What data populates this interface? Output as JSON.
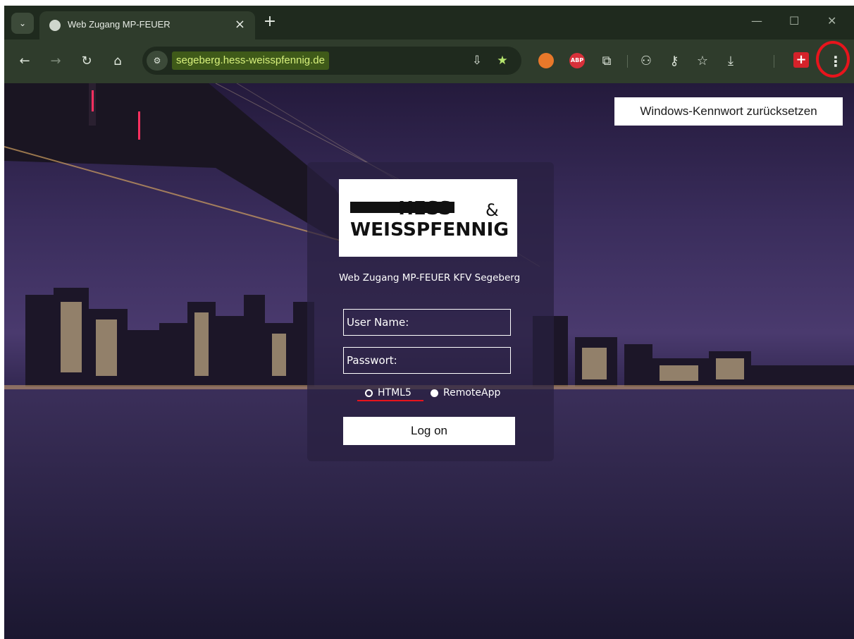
{
  "browser": {
    "tab_title": "Web Zugang MP-FEUER",
    "url": "segeberg.hess-weisspfennig.de"
  },
  "page": {
    "reset_password_label": "Windows-Kennwort zurücksetzen",
    "logo": {
      "line1": "HESS",
      "amp": "&",
      "line2": "WEISSPFENNIG"
    },
    "heading": "Web Zugang MP-FEUER KFV Segeberg",
    "username_placeholder": "User Name:",
    "password_placeholder": "Passwort:",
    "mode_options": [
      {
        "label": "HTML5",
        "selected": false
      },
      {
        "label": "RemoteApp",
        "selected": true
      }
    ],
    "logon_label": "Log on"
  },
  "colors": {
    "annotation_red": "#e8141c",
    "url_highlight": "#d8f17c"
  }
}
